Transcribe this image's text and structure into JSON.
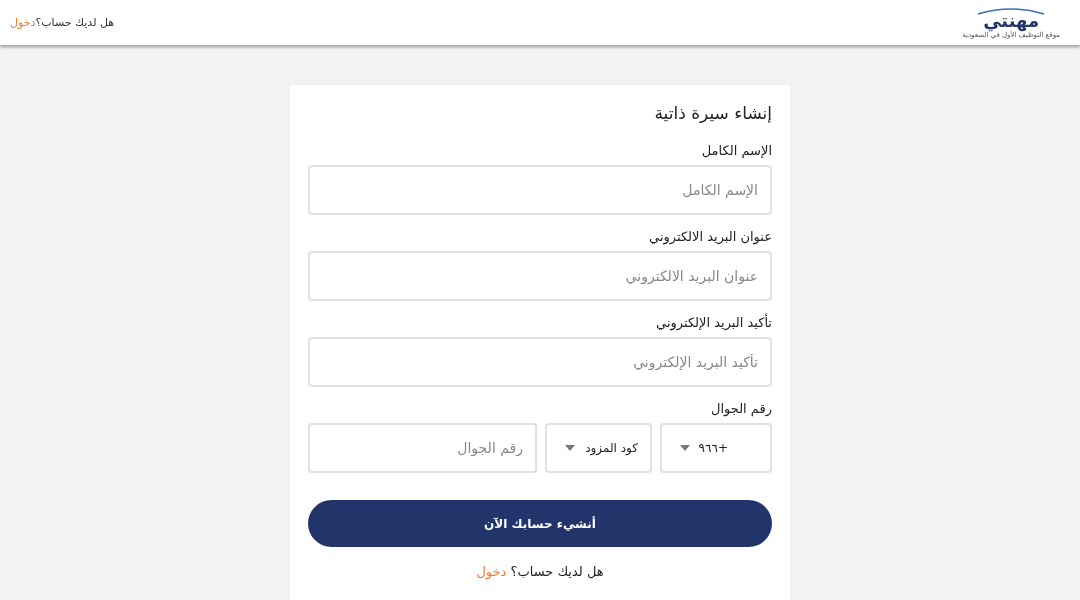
{
  "header": {
    "logo": {
      "name": "مهنتي",
      "tagline": "موقع التوظيف الأول في السعودية"
    },
    "login_prompt": {
      "text": "هل لديك حساب؟",
      "link": "دخول"
    }
  },
  "form": {
    "title": "إنشاء سيرة ذاتية",
    "fields": [
      {
        "label": "الإسم الكامل",
        "placeholder": "الإسم الكامل"
      },
      {
        "label": "عنوان البريد الالكتروني",
        "placeholder": "عنوان البريد الالكتروني"
      },
      {
        "label": "تأكيد البريد الإلكتروني",
        "placeholder": "تأكيد البريد الإلكتروني"
      }
    ],
    "phone": {
      "label": "رقم الجوال",
      "country_code": "+٩٦٦",
      "provider_code": "كود المزود",
      "placeholder": "رقم الجوال"
    },
    "submit": "أنشيء حسابك الآن",
    "login_prompt": {
      "text": "هل لديك حساب؟",
      "link": "دخول"
    }
  }
}
